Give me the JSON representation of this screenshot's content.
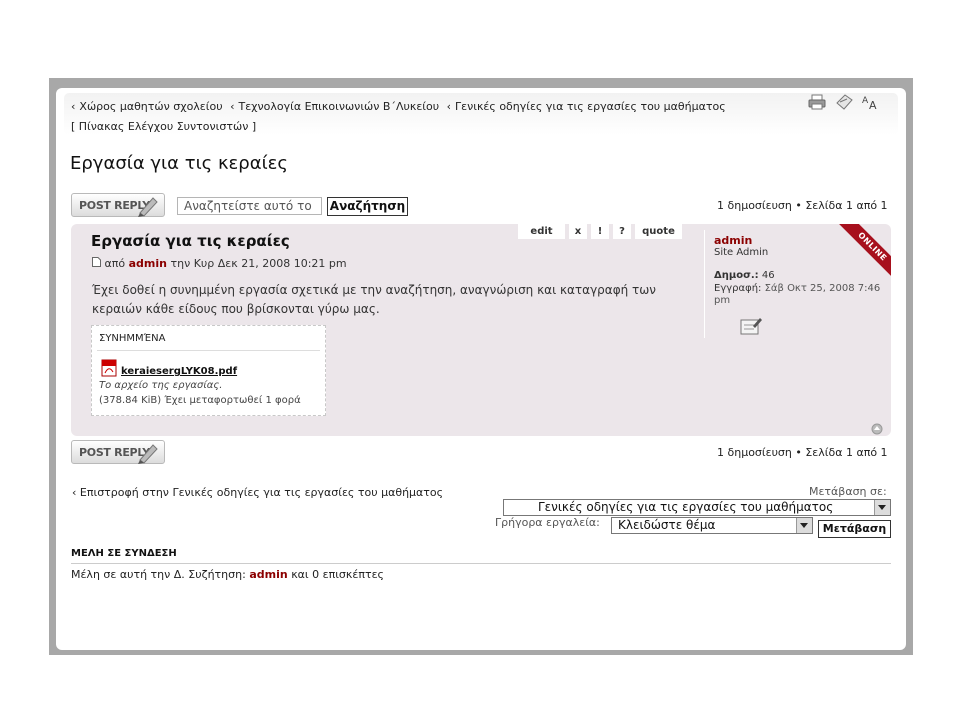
{
  "breadcrumb": {
    "items": [
      "Χώρος μαθητών σχολείου",
      "Τεχνολογία Επικοινωνιών Β΄Λυκείου",
      "Γενικές οδηγίες για τις εργασίες του μαθήματος"
    ],
    "control_panel": "[ Πίνακας Ελέγχου Συντονιστών ]"
  },
  "topic": {
    "title": "Εργασία για τις κεραίες"
  },
  "toolbar": {
    "post_reply_label": "POST REPLY",
    "search_placeholder": "Αναζητείστε αυτό το",
    "search_button": "Αναζήτηση",
    "pagination": "1 δημοσίευση • Σελίδα 1 από 1"
  },
  "post": {
    "title": "Εργασία για τις κεραίες",
    "actions": {
      "edit": "edit",
      "delete": "x",
      "report": "!",
      "info": "?",
      "quote": "quote"
    },
    "meta_prefix": "από",
    "author": "admin",
    "meta_date": "την Κυρ Δεκ 21, 2008 10:21 pm",
    "body": "Έχει δοθεί η συνημμένη εργασία σχετικά με την αναζήτηση, αναγνώριση και καταγραφή των κεραιών κάθε είδους που βρίσκονται γύρω μας.",
    "attachments": {
      "heading": "ΣΥΝΗΜΜΈΝΑ",
      "file_name": "keraiesergLYK08.pdf",
      "comment": "Το αρχείο της εργασίας.",
      "size_info": "(378.84 KiB) Έχει μεταφορτωθεί 1 φορά"
    }
  },
  "profile": {
    "name": "admin",
    "rank": "Site Admin",
    "posts_label": "Δημοσ.:",
    "posts_count": "46",
    "registered_label": "Εγγραφή:",
    "registered_date": "Σάβ Οκτ 25, 2008 7:46 pm",
    "online_badge": "ONLINE"
  },
  "footer": {
    "back_link": "Επιστροφή στην Γενικές οδηγίες για τις εργασίες του μαθήματος",
    "jump_label": "Μετάβαση σε:",
    "jump_value": "Γενικές οδηγίες για τις εργασίες του μαθήματος",
    "quick_tools_label": "Γρήγορα εργαλεία:",
    "quick_tools_value": "Κλειδώστε θέμα",
    "go_button": "Μετάβαση"
  },
  "online": {
    "heading": "ΜΕΛΗ ΣΕ ΣΥΝΔΕΣΗ",
    "text_prefix": "Μέλη σε αυτή την Δ. Συζήτηση:",
    "user": "admin",
    "text_suffix": "και 0 επισκέπτες"
  },
  "colors": {
    "username": "#8b0000",
    "post_bg": "#ece6ea",
    "online_ribbon": "#a7101d"
  }
}
